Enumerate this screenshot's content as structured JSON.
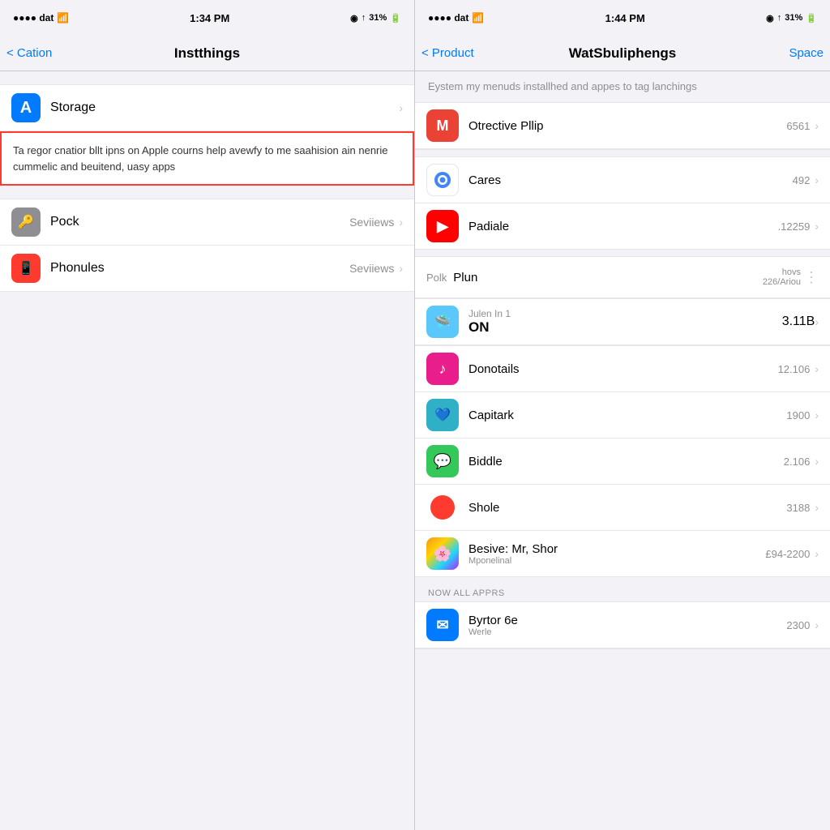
{
  "left": {
    "status": {
      "carrier": "●●●● dat",
      "wifi": "WiFi",
      "time": "1:34 PM",
      "location": "◉",
      "signal": "↑",
      "battery": "31%"
    },
    "nav": {
      "back": "< Cation",
      "title": "Instthings"
    },
    "storage_item": {
      "label": "Storage",
      "icon": "A"
    },
    "description": "Ta regor cnatior bllt ipns on Apple courns help avewfy to me saahision ain nenrie cummelic and beuitend, uasy apps",
    "items": [
      {
        "icon": "🔑",
        "label": "Pock",
        "meta": "Seviiews"
      },
      {
        "icon": "📱",
        "label": "Phonules",
        "meta": "Seviiews"
      }
    ]
  },
  "right": {
    "status": {
      "carrier": "●●●● dat",
      "wifi": "WiFi",
      "time": "1:44 PM",
      "location": "◉",
      "signal": "↑",
      "battery": "31%"
    },
    "nav": {
      "back": "< Product",
      "title": "WatSbuliphengs",
      "action": "Space"
    },
    "subtitle": "Eystem my menuds installhed and appes to tag lanchings",
    "top_apps": [
      {
        "name": "Otrective Pllip",
        "size": "6561",
        "icon_class": "app-icon-gmail",
        "icon_text": "M"
      }
    ],
    "apps": [
      {
        "name": "Cares",
        "size": "492",
        "icon_class": "app-icon-chrome",
        "icon_text": "⬤"
      },
      {
        "name": "Padiale",
        "size": ".12259",
        "icon_class": "app-icon-youtube",
        "icon_text": "▶"
      },
      {
        "name": "Donotails",
        "size": "12.106",
        "icon_class": "app-icon-pink",
        "icon_text": "♪"
      },
      {
        "name": "Capitark",
        "size": "1900",
        "icon_class": "app-icon-cyan",
        "icon_text": "🔵"
      },
      {
        "name": "Biddle",
        "size": "2.106",
        "icon_class": "app-icon-green",
        "icon_text": "💬"
      },
      {
        "name": "Shole",
        "size": "3188",
        "icon_class": "app-icon-dotred",
        "icon_text": "⬤"
      },
      {
        "name": "Besive: Mr, Shor",
        "subtitle": "Mponelinal",
        "size": "£94-2200",
        "icon_class": "app-icon-photos",
        "icon_text": ""
      }
    ],
    "polk": {
      "label": "Polk",
      "name": "Plun",
      "meta1": "hovs",
      "meta2": "226/Ariou"
    },
    "julen": {
      "title": "Julen In 1",
      "subtitle": "ON",
      "size": "3.11B"
    },
    "section_label": "NOW ALL APPRS",
    "bottom_apps": [
      {
        "name": "Byrtor 6e",
        "subtitle": "Werle",
        "size": "2300",
        "icon_class": "app-icon-blue",
        "icon_text": "✉"
      }
    ]
  }
}
